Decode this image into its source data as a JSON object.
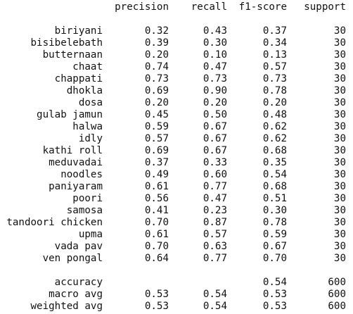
{
  "header": {
    "precision": "precision",
    "recall": "recall",
    "f1": "f1-score",
    "support": "support"
  },
  "rows": [
    {
      "label": "biriyani",
      "precision": "0.32",
      "recall": "0.43",
      "f1": "0.37",
      "support": "30"
    },
    {
      "label": "bisibelebath",
      "precision": "0.39",
      "recall": "0.30",
      "f1": "0.34",
      "support": "30"
    },
    {
      "label": "butternaan",
      "precision": "0.20",
      "recall": "0.10",
      "f1": "0.13",
      "support": "30"
    },
    {
      "label": "chaat",
      "precision": "0.74",
      "recall": "0.47",
      "f1": "0.57",
      "support": "30"
    },
    {
      "label": "chappati",
      "precision": "0.73",
      "recall": "0.73",
      "f1": "0.73",
      "support": "30"
    },
    {
      "label": "dhokla",
      "precision": "0.69",
      "recall": "0.90",
      "f1": "0.78",
      "support": "30"
    },
    {
      "label": "dosa",
      "precision": "0.20",
      "recall": "0.20",
      "f1": "0.20",
      "support": "30"
    },
    {
      "label": "gulab jamun",
      "precision": "0.45",
      "recall": "0.50",
      "f1": "0.48",
      "support": "30"
    },
    {
      "label": "halwa",
      "precision": "0.59",
      "recall": "0.67",
      "f1": "0.62",
      "support": "30"
    },
    {
      "label": "idly",
      "precision": "0.57",
      "recall": "0.67",
      "f1": "0.62",
      "support": "30"
    },
    {
      "label": "kathi roll",
      "precision": "0.69",
      "recall": "0.67",
      "f1": "0.68",
      "support": "30"
    },
    {
      "label": "meduvadai",
      "precision": "0.37",
      "recall": "0.33",
      "f1": "0.35",
      "support": "30"
    },
    {
      "label": "noodles",
      "precision": "0.49",
      "recall": "0.60",
      "f1": "0.54",
      "support": "30"
    },
    {
      "label": "paniyaram",
      "precision": "0.61",
      "recall": "0.77",
      "f1": "0.68",
      "support": "30"
    },
    {
      "label": "poori",
      "precision": "0.56",
      "recall": "0.47",
      "f1": "0.51",
      "support": "30"
    },
    {
      "label": "samosa",
      "precision": "0.41",
      "recall": "0.23",
      "f1": "0.30",
      "support": "30"
    },
    {
      "label": "tandoori chicken",
      "precision": "0.70",
      "recall": "0.87",
      "f1": "0.78",
      "support": "30"
    },
    {
      "label": "upma",
      "precision": "0.61",
      "recall": "0.57",
      "f1": "0.59",
      "support": "30"
    },
    {
      "label": "vada pav",
      "precision": "0.70",
      "recall": "0.63",
      "f1": "0.67",
      "support": "30"
    },
    {
      "label": "ven pongal",
      "precision": "0.64",
      "recall": "0.77",
      "f1": "0.70",
      "support": "30"
    }
  ],
  "summary": [
    {
      "label": "accuracy",
      "precision": "",
      "recall": "",
      "f1": "0.54",
      "support": "600"
    },
    {
      "label": "macro avg",
      "precision": "0.53",
      "recall": "0.54",
      "f1": "0.53",
      "support": "600"
    },
    {
      "label": "weighted avg",
      "precision": "0.53",
      "recall": "0.54",
      "f1": "0.53",
      "support": "600"
    }
  ]
}
